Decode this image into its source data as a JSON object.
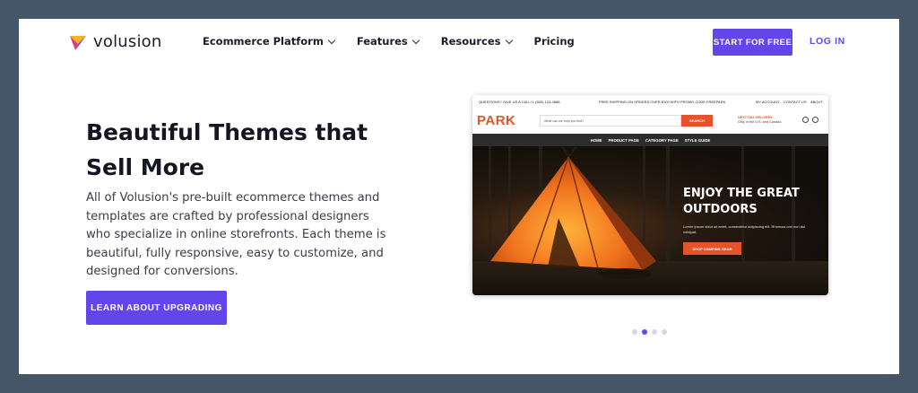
{
  "brand": {
    "name": "volusion"
  },
  "nav": {
    "items": [
      {
        "label": "Ecommerce Platform",
        "dropdown": true
      },
      {
        "label": "Features",
        "dropdown": true
      },
      {
        "label": "Resources",
        "dropdown": true
      },
      {
        "label": "Pricing",
        "dropdown": false
      }
    ],
    "cta_label": "START FOR FREE",
    "login_label": "LOG IN"
  },
  "hero": {
    "title": "Beautiful Themes that Sell More",
    "description": "All of Volusion's pre-built ecommerce themes and templates are crafted by professional designers who specialize in online storefronts. Each theme is beautiful, fully responsive, easy to customize, and designed for conversions.",
    "button_label": "LEARN ABOUT UPGRADING"
  },
  "preview": {
    "topbar_left": "QUESTIONS? GIVE US A CALL! 1 (800) 123-4588",
    "topbar_center": "FREE SHIPPING ON ORDERS OVER $100 WITH PROMO CODE FREEPARK",
    "topbar_links": [
      "MY ACCOUNT",
      "CONTACT US",
      "ABOUT"
    ],
    "store_name": "PARK",
    "search_placeholder": "What can we help you find?",
    "search_button": "SEARCH",
    "delivery_title": "NEXT DAY DELIVERY",
    "delivery_sub": "Only in the U.S. and Canada",
    "menu": [
      "HOME",
      "PRODUCT PAGE",
      "CATEGORY PAGE",
      "STYLE GUIDE"
    ],
    "headline": "ENJOY THE GREAT OUTDOORS",
    "subtext": "Lorem ipsum dolor sit amet, consectetur adipiscing elit. Rhoncus orci non dui volutpat.",
    "shop_button": "SHOP CAMPING GEAR"
  },
  "carousel": {
    "total": 4,
    "active": 2
  },
  "colors": {
    "accent": "#6246ea",
    "frame": "#465669",
    "store_accent": "#e4532a"
  }
}
